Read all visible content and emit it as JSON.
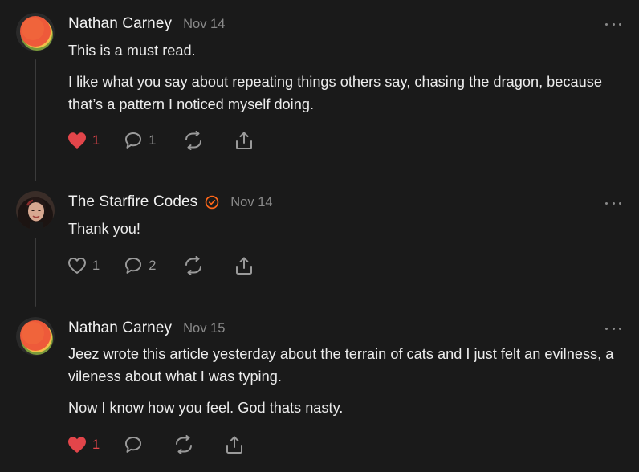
{
  "comments": [
    {
      "author": "Nathan Carney",
      "date": "Nov 14",
      "paragraphs": [
        "This is a must read.",
        "I like what you say about repeating things others say, chasing the dragon, because that’s a pattern I noticed myself doing."
      ],
      "likes": "1",
      "liked": true,
      "replies": "1",
      "verified": false
    },
    {
      "author": "The Starfire Codes",
      "date": "Nov 14",
      "paragraphs": [
        "Thank you!"
      ],
      "likes": "1",
      "liked": false,
      "replies": "2",
      "verified": true
    },
    {
      "author": "Nathan Carney",
      "date": "Nov 15",
      "paragraphs": [
        "Jeez wrote this article yesterday about the terrain of cats and I just felt an evilness, a vileness about what I was typing.",
        "Now I know how you feel. God thats nasty."
      ],
      "likes": "1",
      "liked": true,
      "replies": "",
      "verified": false
    }
  ],
  "colors": {
    "background": "#1a1a1a",
    "liked_red": "#e2454a",
    "verified_orange": "#ff6719",
    "muted": "#8a8a8a"
  },
  "icons": [
    "heart-icon",
    "comment-icon",
    "restack-icon",
    "share-icon",
    "more-dots-icon",
    "verified-badge-icon"
  ]
}
